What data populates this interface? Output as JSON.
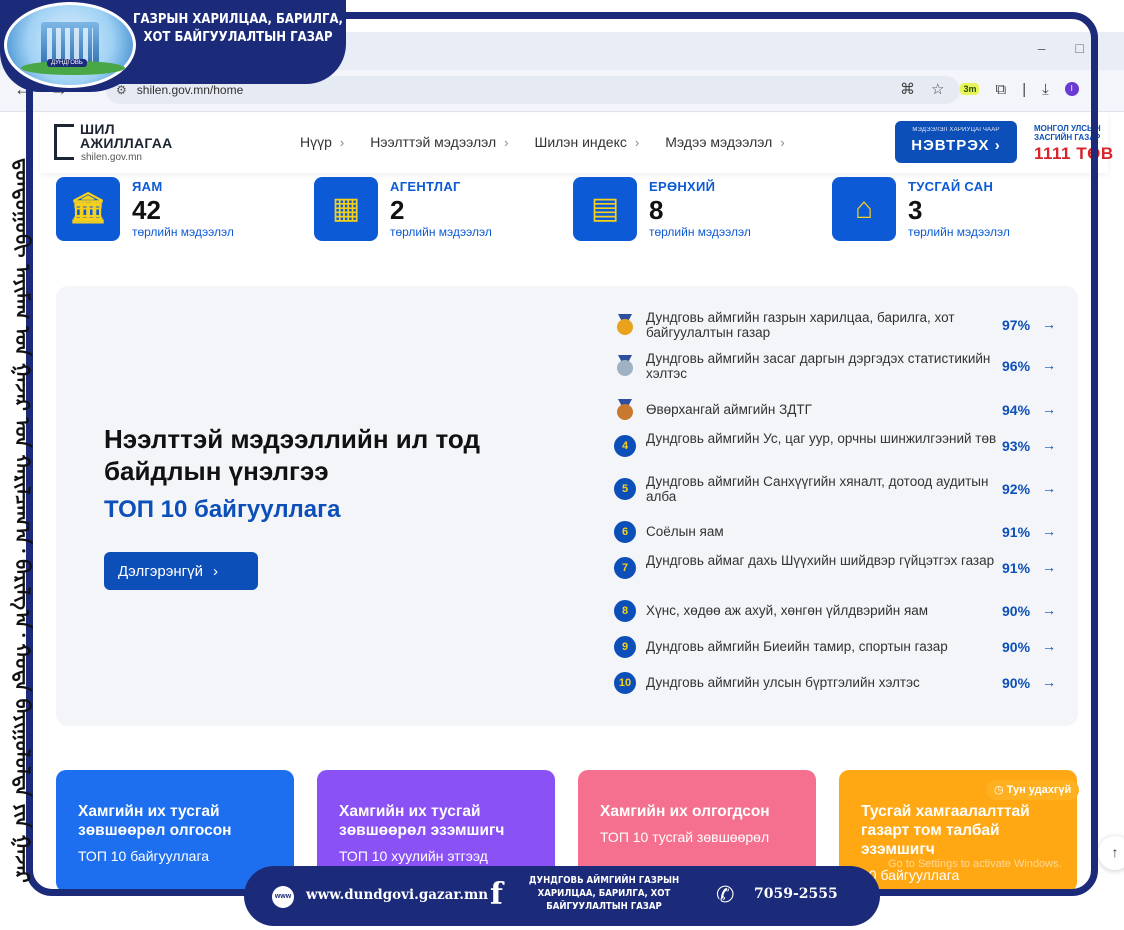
{
  "overlay": {
    "org_title": "ГАЗРЫН ХАРИЛЦАА, БАРИЛГА, ХОТ БАЙГУУЛАЛТЫН ГАЗАР",
    "vertical_text": "ᠳ᠋ᠤᠨᠳᠤᠭᠣᠪᠢ ᠠᠶᠢᠮᠠᠭ ᠤᠨ ᠭᠠᠵᠠᠷ ᠤᠨ ᠬᠠᠷᠢᠯᠴᠠᠭ᠎ᠠ᠂ ᠪᠠᠷᠢᠯᠭ᠎ᠠ᠂ ᠬᠣᠲᠠ ᠪᠠᠶᠢᠭᠤᠯᠤᠯᠲᠠ ᠶᠢᠨ ᠭᠠᠵᠠᠷ",
    "logo_tag": "ДУНДГОВЬ"
  },
  "browser": {
    "url": "shilen.gov.mn/home",
    "extension_badge": "3m",
    "profile": "I"
  },
  "header": {
    "logo_line1": "ШИЛ",
    "logo_line2": "АЖИЛЛАГАА",
    "logo_url": "shilen.gov.mn",
    "menu": [
      "Нүүр",
      "Нээлттэй мэдээлэл",
      "Шилэн индекс",
      "Мэдээ мэдээлэл"
    ],
    "login_small": "МЭДЭЭЛЭЛ ХАРИУЦАГЧААР",
    "login_big": "НЭВТРЭХ",
    "gov_top": "МОНГОЛ УЛСЫН ЗАСГИЙН ГАЗАР",
    "gov_bottom": "1111 ТӨВ"
  },
  "stats": [
    {
      "label": "ЯАМ",
      "value": "42",
      "sub": "төрлийн мэдээлэл",
      "icon": "ministry-icon"
    },
    {
      "label": "АГЕНТЛАГ",
      "value": "2",
      "sub": "төрлийн мэдээлэл",
      "icon": "agency-building-icon"
    },
    {
      "label": "ЕРӨНХИЙ",
      "value": "8",
      "sub": "төрлийн мэдээлэл",
      "icon": "document-icon"
    },
    {
      "label": "ТУСГАЙ САН",
      "value": "3",
      "sub": "төрлийн мэдээлэл",
      "icon": "special-fund-icon"
    }
  ],
  "ranking": {
    "title_line1": "Нээлттэй мэдээллийн ил тод",
    "title_line2": "байдлын үнэлгээ",
    "subtitle": "ТОП 10 байгууллага",
    "more_button": "Дэлгэрэнгүй",
    "items": [
      {
        "rank": "1",
        "name": "Дундговь аймгийн газрын харилцаа, барилга, хот байгуулалтын газар",
        "pct": "97%",
        "medal": "gold"
      },
      {
        "rank": "2",
        "name": "Дундговь аймгийн засаг даргын дэргэдэх статистикийн хэлтэс",
        "pct": "96%",
        "medal": "silver"
      },
      {
        "rank": "3",
        "name": "Өвөрхангай аймгийн ЗДТГ",
        "pct": "94%",
        "medal": "bronze"
      },
      {
        "rank": "4",
        "name": "Дундговь аймгийн Ус, цаг уур, орчны шинжилгээний төв",
        "pct": "93%",
        "medal": ""
      },
      {
        "rank": "5",
        "name": "Дундговь аймгийн Санхүүгийн хяналт, дотоод аудитын алба",
        "pct": "92%",
        "medal": ""
      },
      {
        "rank": "6",
        "name": "Соёлын яам",
        "pct": "91%",
        "medal": ""
      },
      {
        "rank": "7",
        "name": "Дундговь аймаг дахь Шүүхийн шийдвэр гүйцэтгэх газар",
        "pct": "91%",
        "medal": ""
      },
      {
        "rank": "8",
        "name": "Хүнс, хөдөө аж ахуй, хөнгөн үйлдвэрийн яам",
        "pct": "90%",
        "medal": ""
      },
      {
        "rank": "9",
        "name": "Дундговь аймгийн Биеийн тамир, спортын газар",
        "pct": "90%",
        "medal": ""
      },
      {
        "rank": "10",
        "name": "Дундговь аймгийн улсын бүртгэлийн хэлтэс",
        "pct": "90%",
        "medal": ""
      }
    ]
  },
  "cards": [
    {
      "title": "Хамгийн их тусгай зөвшөөрөл олгосон",
      "sub": "ТОП 10 байгууллага",
      "color": "#1e6ff0"
    },
    {
      "title": "Хамгийн их тусгай зөвшөөрөл эзэмшигч",
      "sub": "ТОП 10 хуулийн этгээд",
      "color": "#8a52f5"
    },
    {
      "title": "Хамгийн их олгогдсон",
      "sub": "ТОП 10 тусгай зөвшөөрөл",
      "color": "#f5708e"
    },
    {
      "title": "Тусгай хамгаалалттай газарт том талбай эзэмшигч",
      "sub": "10 байгууллага",
      "color": "#ffa814"
    }
  ],
  "soon_badge": "Тун удахгүй",
  "watermark": "Go to Settings to activate Windows.",
  "footer": {
    "website": "www.dundgovi.gazar.mn",
    "org": "ДУНДГОВЬ АЙМГИЙН ГАЗРЫН ХАРИЛЦАА, БАРИЛГА, ХОТ БАЙГУУЛАЛТЫН ГАЗАР",
    "phone": "7059-2555"
  },
  "colors": {
    "navy": "#1b2b7a",
    "primary": "#0d4fb8",
    "accent_yellow": "#f7d01c"
  }
}
